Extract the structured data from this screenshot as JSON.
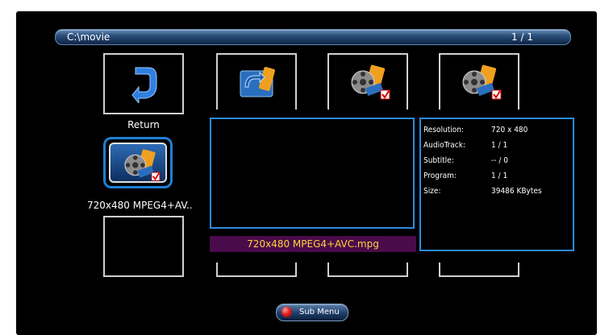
{
  "path_bar": {
    "path": "C:\\movie",
    "page_indicator": "1 / 1"
  },
  "tiles": {
    "return_label": "Return",
    "selected_label": "720x480 MPEG4+AV.."
  },
  "filename_bar": {
    "text": "720x480 MPEG4+AVC.mpg"
  },
  "info": {
    "rows": [
      {
        "key": "Resolution:",
        "value": "720 x 480"
      },
      {
        "key": "AudioTrack:",
        "value": "1 / 1"
      },
      {
        "key": "Subtitle:",
        "value": "-- / 0"
      },
      {
        "key": "Program:",
        "value": "1 / 1"
      },
      {
        "key": "Size:",
        "value": "39486 KBytes"
      }
    ]
  },
  "bottom": {
    "sub_menu_label": "Sub Menu"
  },
  "colors": {
    "selection_border": "#1f7fd6",
    "filename_bg": "#4a0b4b",
    "filename_text": "#ffd23a"
  }
}
